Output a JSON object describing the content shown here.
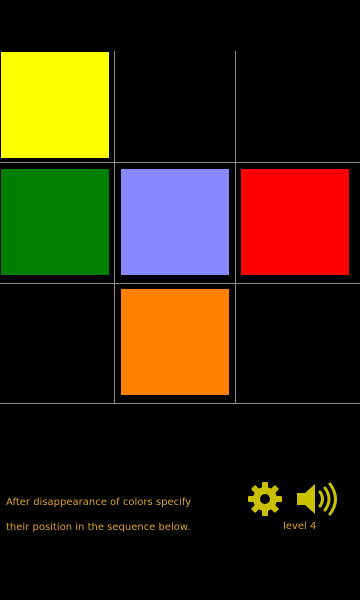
{
  "grid": {
    "rows": 3,
    "cols": 3,
    "cells": [
      {
        "row": 0,
        "col": 0,
        "color": "#ffff00",
        "name": "yellow"
      },
      {
        "row": 0,
        "col": 1,
        "color": null,
        "name": "empty"
      },
      {
        "row": 0,
        "col": 2,
        "color": null,
        "name": "empty"
      },
      {
        "row": 1,
        "col": 0,
        "color": "#008000",
        "name": "green"
      },
      {
        "row": 1,
        "col": 1,
        "color": "#8888ff",
        "name": "lavender"
      },
      {
        "row": 1,
        "col": 2,
        "color": "#ff0000",
        "name": "red"
      },
      {
        "row": 2,
        "col": 0,
        "color": null,
        "name": "empty"
      },
      {
        "row": 2,
        "col": 1,
        "color": "#ff8000",
        "name": "orange"
      },
      {
        "row": 2,
        "col": 2,
        "color": null,
        "name": "empty"
      }
    ],
    "line_color": "#8a8a8a"
  },
  "instructions": {
    "line1": "After disappearance of colors specify",
    "line2": "their position in the sequence below."
  },
  "controls": {
    "settings_icon": "gear-icon",
    "sound_icon": "speaker-icon",
    "icon_color": "#c9c000"
  },
  "level_label": "level 4",
  "text_color": "#d9a326"
}
